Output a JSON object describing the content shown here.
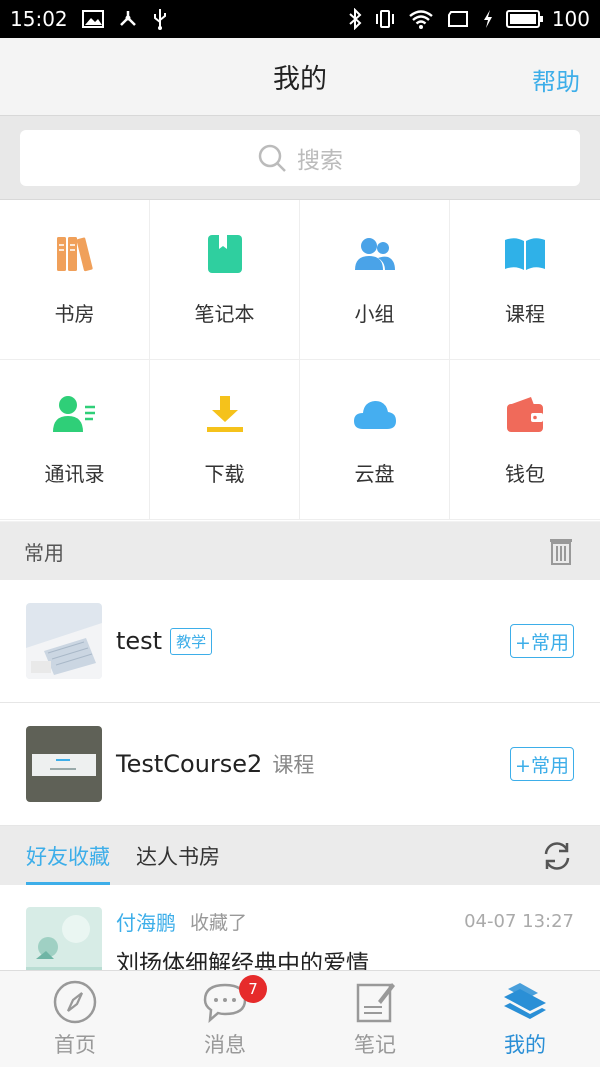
{
  "status_bar": {
    "time": "15:02",
    "battery_level": "100"
  },
  "header": {
    "title": "我的",
    "help": "帮助"
  },
  "search": {
    "placeholder": "搜索"
  },
  "grid": [
    {
      "label": "书房",
      "icon": "bookshelf-icon",
      "color": "#f0a05a"
    },
    {
      "label": "笔记本",
      "icon": "notebook-icon",
      "color": "#2fcf9f"
    },
    {
      "label": "小组",
      "icon": "group-icon",
      "color": "#4aa3e8"
    },
    {
      "label": "课程",
      "icon": "open-book-icon",
      "color": "#2fb1e8"
    },
    {
      "label": "通讯录",
      "icon": "contacts-icon",
      "color": "#2fcf78"
    },
    {
      "label": "下载",
      "icon": "download-icon",
      "color": "#f5c21b"
    },
    {
      "label": "云盘",
      "icon": "cloud-icon",
      "color": "#45aef0"
    },
    {
      "label": "钱包",
      "icon": "wallet-icon",
      "color": "#f06a5a"
    }
  ],
  "common_section": {
    "title": "常用"
  },
  "common_list": [
    {
      "name": "test",
      "badge": "教学",
      "button": "+常用"
    },
    {
      "name": "TestCourse2",
      "tag": "课程",
      "button": "+常用"
    }
  ],
  "tabs": [
    {
      "label": "好友收藏",
      "active": true
    },
    {
      "label": "达人书房",
      "active": false
    }
  ],
  "feed": {
    "user": "付海鹏",
    "action": "收藏了",
    "time": "04-07 13:27",
    "text": "刘扬体细解经典中的爱情"
  },
  "bottom_nav": [
    {
      "label": "首页",
      "icon": "compass-icon",
      "active": false
    },
    {
      "label": "消息",
      "icon": "chat-bubble-icon",
      "badge": "7",
      "active": false
    },
    {
      "label": "笔记",
      "icon": "note-icon",
      "active": false
    },
    {
      "label": "我的",
      "icon": "layers-icon",
      "active": true
    }
  ],
  "colors": {
    "accent": "#3daee9",
    "active_nav": "#2a8fd6",
    "badge_red": "#e62b2b"
  }
}
